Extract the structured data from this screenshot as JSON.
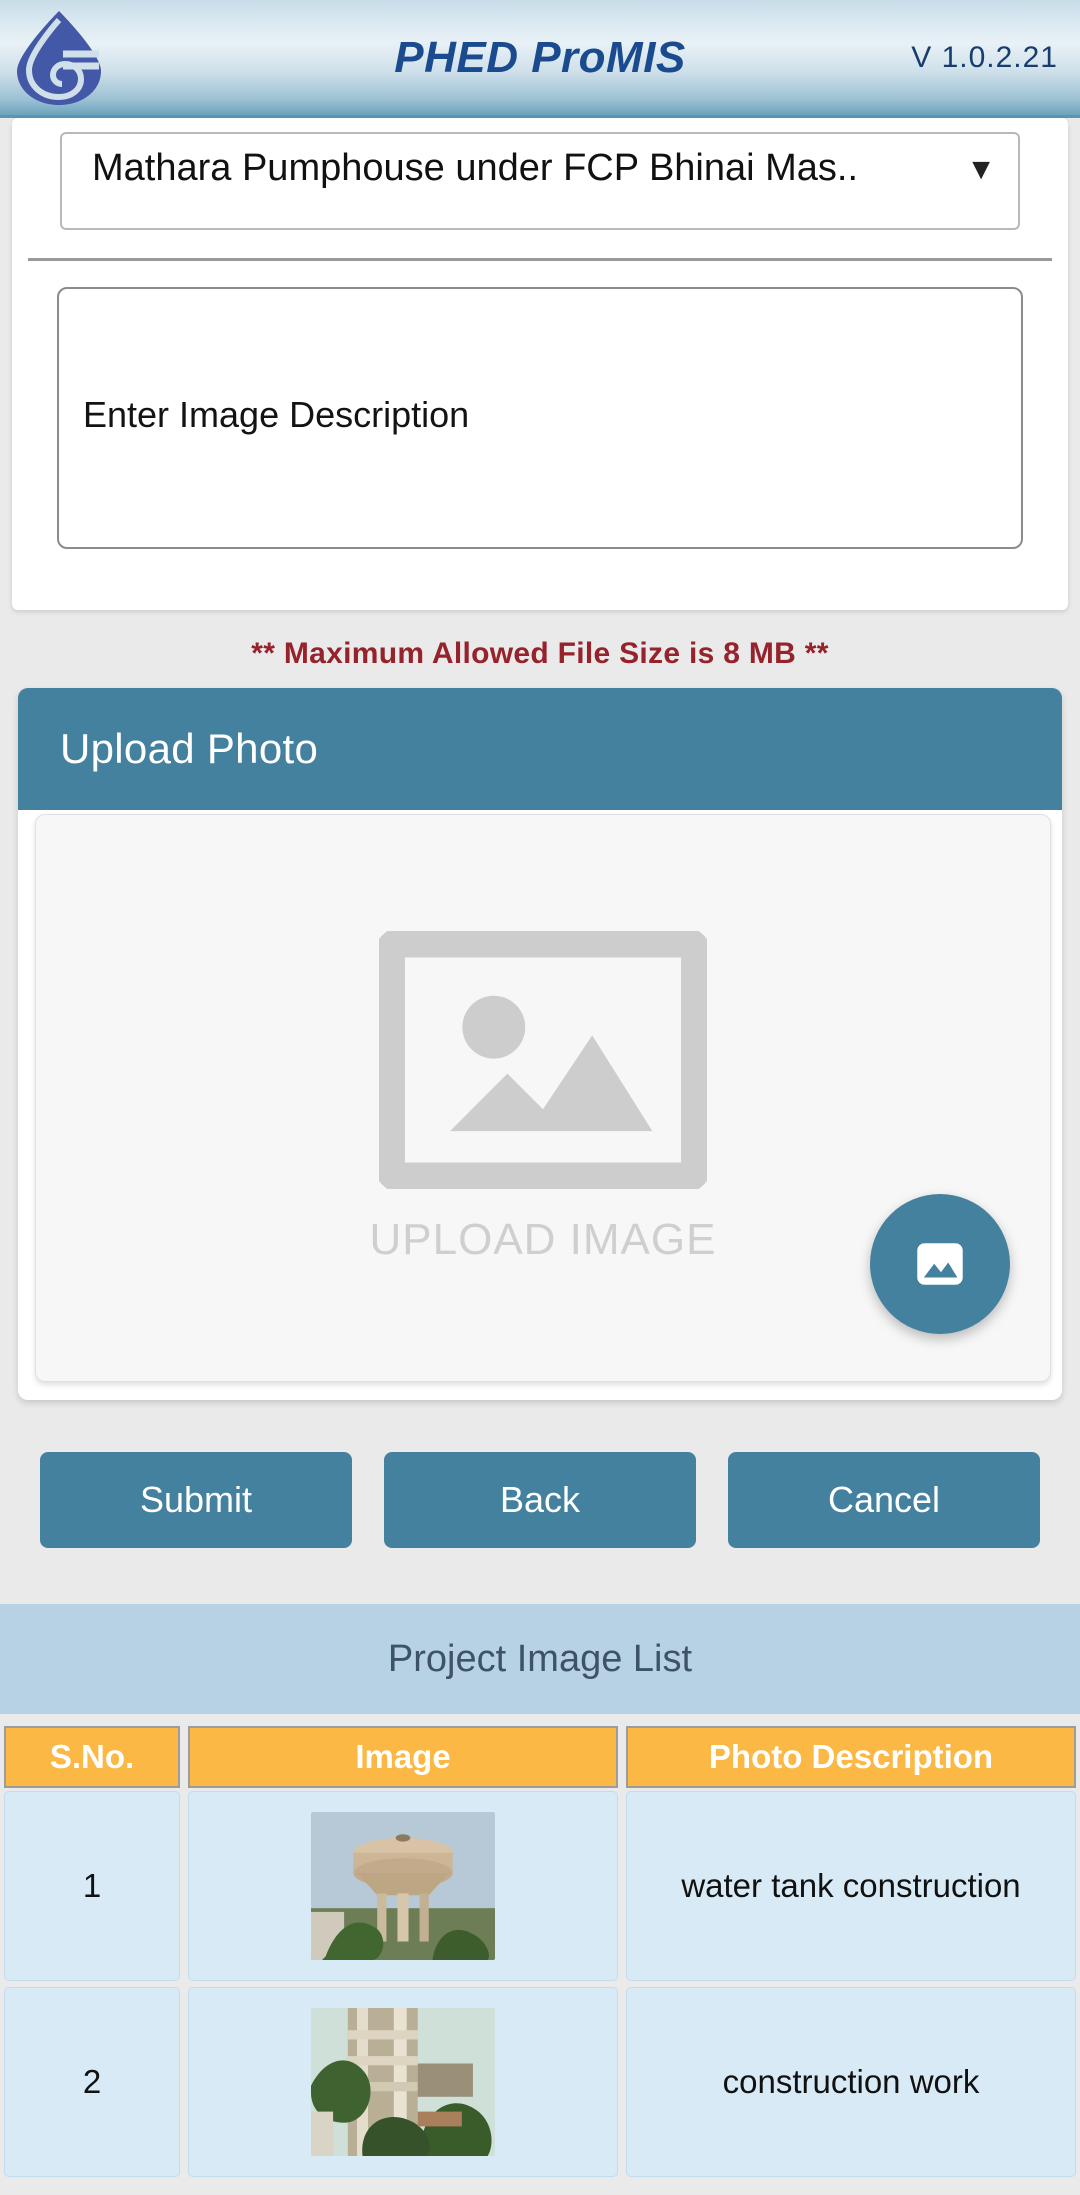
{
  "header": {
    "logo_icon": "water-drop-logo",
    "title": "PHED ProMIS",
    "version": "V 1.0.2.21",
    "accent": "#1b4b8f"
  },
  "form": {
    "project_select": {
      "value": "Mathara Pumphouse under FCP Bhinai Mas..",
      "caret_icon": "chevron-down-icon"
    },
    "description": {
      "placeholder": "Enter Image Description",
      "value": ""
    }
  },
  "warning": {
    "text": "** Maximum Allowed File Size is 8 MB **",
    "color": "#96222b"
  },
  "upload": {
    "header_title": "Upload Photo",
    "placeholder_label": "UPLOAD IMAGE",
    "placeholder_icon": "image-placeholder-icon",
    "fab_icon": "photo-library-icon",
    "accent": "#44819f"
  },
  "actions": {
    "submit_label": "Submit",
    "back_label": "Back",
    "cancel_label": "Cancel"
  },
  "list": {
    "title": "Project Image List",
    "columns": [
      "S.No.",
      "Image",
      "Photo Description"
    ],
    "header_bg": "#fbb845",
    "row_bg": "#d9eaf7",
    "rows": [
      {
        "sno": "1",
        "image_alt": "water-tower-photo",
        "description": "water tank construction"
      },
      {
        "sno": "2",
        "image_alt": "building-construction-photo",
        "description": "construction work"
      }
    ]
  }
}
